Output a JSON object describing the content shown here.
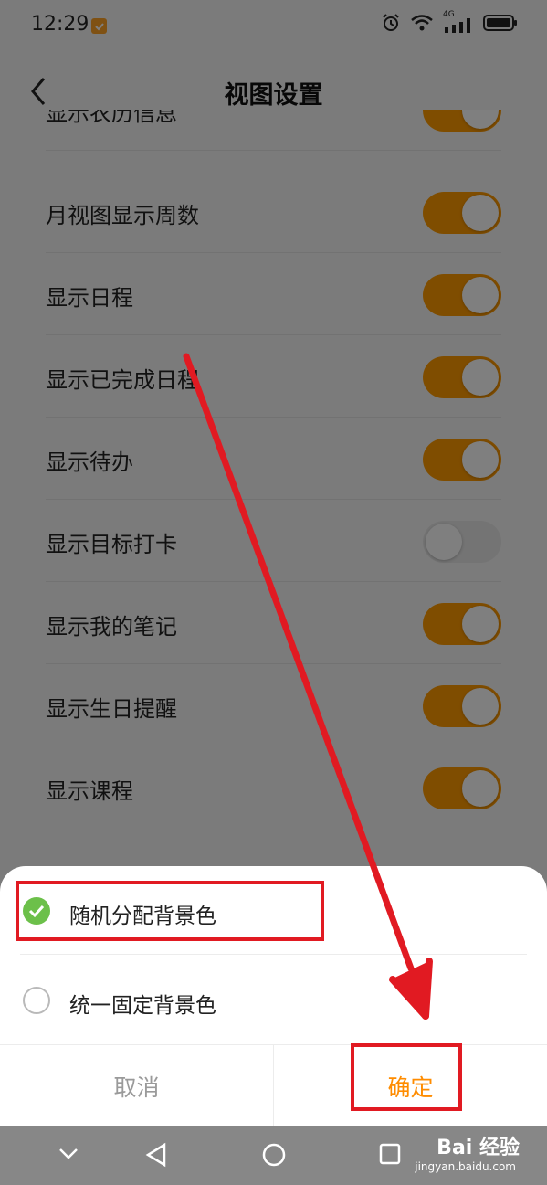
{
  "status_bar": {
    "time": "12:29",
    "network": "4G"
  },
  "header": {
    "title": "视图设置"
  },
  "settings": [
    {
      "label": "显示农历信息",
      "enabled": true
    },
    {
      "label": "月视图显示周数",
      "enabled": true
    },
    {
      "label": "显示日程",
      "enabled": true
    },
    {
      "label": "显示已完成日程",
      "enabled": true
    },
    {
      "label": "显示待办",
      "enabled": true
    },
    {
      "label": "显示目标打卡",
      "enabled": false
    },
    {
      "label": "显示我的笔记",
      "enabled": true
    },
    {
      "label": "显示生日提醒",
      "enabled": true
    },
    {
      "label": "显示课程",
      "enabled": true
    }
  ],
  "sheet": {
    "options": [
      {
        "label": "随机分配背景色",
        "selected": true
      },
      {
        "label": "统一固定背景色",
        "selected": false
      }
    ],
    "cancel_label": "取消",
    "confirm_label": "确定"
  },
  "watermark": {
    "brand": "Bai 经验",
    "url": "jingyan.baidu.com"
  },
  "colors": {
    "accent": "#ff9a00",
    "check": "#6cc04a",
    "annotation": "#e11a22"
  }
}
